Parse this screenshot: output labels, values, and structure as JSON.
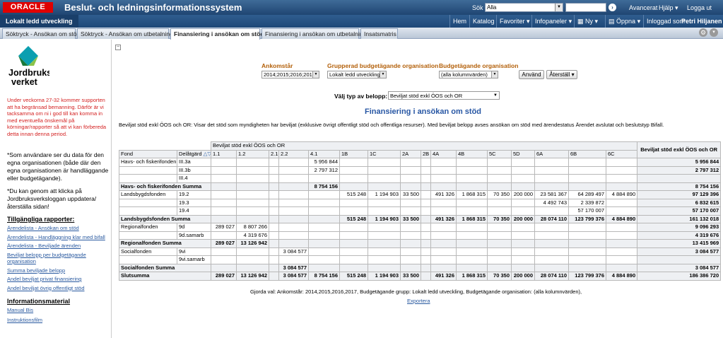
{
  "header": {
    "logo": "ORACLE",
    "app_title": "Beslut- och ledningsinformationssystem",
    "search_label": "Sök",
    "search_scope": "Alla",
    "advanced": "Avancerat",
    "help": "Hjälp",
    "logout": "Logga ut"
  },
  "nav": {
    "context": "Lokalt ledd utveckling",
    "items": [
      "Hem",
      "Katalog",
      "Favoriter",
      "Infopaneler",
      "Ny",
      "Öppna",
      "Inloggad som",
      "Petri Hiljanen"
    ]
  },
  "tabs": [
    "Söktryck - Ansökan om stöd",
    "Söktryck - Ansökan om utbetalning",
    "Finansiering i ansökan om stöd",
    "Finansiering i ansökan om utbetalning",
    "Insatsmatris"
  ],
  "sidebar": {
    "logo_text_1": "Jordbruks",
    "logo_text_2": "verket",
    "notice": "Under veckorna 27-32 kommer supporten att ha begränsad bemanning. Därför är vi tacksamma om ni i god till kan komma in med eventuella önskemål på körningar/rapporter så att vi kan förbereda detta innan denna period.",
    "info1": "*Som användare ser du data för den egna organisationen (både där den egna organisationen är handläggande eller budgetägande).",
    "info2": "*Du kan genom att klicka på Jordbruksverksloggan uppdatera/återställa sidan!",
    "reports_heading": "Tillgängliga rapporter:",
    "reports": [
      "Ärendelista - Ansökan om stöd",
      "Ärendelista - Handläggning klar med bifall",
      "Ärendelista - Beviljade ärenden",
      "Beviljat belopp per budgetägande organisation",
      "Summa beviljade belopp",
      "Andel beviljat privat finansiering",
      "Andel beviljat övrig offentligt stöd"
    ],
    "info_heading": "Informationsmaterial",
    "info_links": [
      "Manual Bis",
      "Instruktionsfilm"
    ]
  },
  "prompts": {
    "ankomstar_label": "Ankomstår",
    "ankomstar_value": "2014;2015;2016;2017",
    "grupp_label": "Grupperad budgetägande organisation",
    "grupp_value": "Lokalt ledd utveckling",
    "budget_label": "Budgetägande organisation",
    "budget_value": "(alla kolumnvärden)",
    "apply": "Använd",
    "reset": "Återställ",
    "type_label": "Välj typ av belopp:",
    "type_value": "Beviljat stöd exkl ÖOS och OR"
  },
  "report": {
    "title": "Finansiering i ansökan om stöd",
    "description": "Beviljat stöd exkl ÖOS och OR: Visar det stöd som myndigheten har beviljat (exklusive övrigt offentligt stöd och offentliga resurser). Med beviljat belopp avses ansökan om stöd med ärendestatus Ärendet avslutat och beslutstyp Bifall.",
    "measure_header": "Beviljat stöd exkl ÖOS och OR",
    "total_header": "Beviljat stöd exkl ÖOS och OR",
    "col_fond": "Fond",
    "col_delatgard": "Delåtgärd",
    "columns": [
      "1.1",
      "1.2",
      "2.1",
      "2.2",
      "4.1",
      "1B",
      "1C",
      "2A",
      "2B",
      "4A",
      "4B",
      "5C",
      "5D",
      "6A",
      "6B",
      "6C"
    ],
    "rows": [
      {
        "fond": "Havs- och fiskerifonden",
        "del": "III.3a",
        "cells": [
          "",
          "",
          "",
          "",
          "5 956 844",
          "",
          "",
          "",
          "",
          "",
          "",
          "",
          "",
          "",
          "",
          ""
        ],
        "total": "5 956 844"
      },
      {
        "fond": "",
        "del": "III.3b",
        "cells": [
          "",
          "",
          "",
          "",
          "2 797 312",
          "",
          "",
          "",
          "",
          "",
          "",
          "",
          "",
          "",
          "",
          ""
        ],
        "total": "2 797 312"
      },
      {
        "fond": "",
        "del": "III.4",
        "cells": [
          "",
          "",
          "",
          "",
          "",
          "",
          "",
          "",
          "",
          "",
          "",
          "",
          "",
          "",
          "",
          ""
        ],
        "total": ""
      },
      {
        "sum": true,
        "fond": "Havs- och fiskerifonden Summa",
        "cells": [
          "",
          "",
          "",
          "",
          "8 754 156",
          "",
          "",
          "",
          "",
          "",
          "",
          "",
          "",
          "",
          "",
          ""
        ],
        "total": "8 754 156"
      },
      {
        "fond": "Landsbygdsfonden",
        "del": "19.2",
        "cells": [
          "",
          "",
          "",
          "",
          "",
          "515 248",
          "1 194 903",
          "33 500",
          "",
          "491 326",
          "1 868 315",
          "70 350",
          "200 000",
          "23 581 367",
          "64 289 497",
          "4 884 890"
        ],
        "total": "97 129 396"
      },
      {
        "fond": "",
        "del": "19.3",
        "cells": [
          "",
          "",
          "",
          "",
          "",
          "",
          "",
          "",
          "",
          "",
          "",
          "",
          "",
          "4 492 743",
          "2 339 872",
          ""
        ],
        "total": "6 832 615"
      },
      {
        "fond": "",
        "del": "19.4",
        "cells": [
          "",
          "",
          "",
          "",
          "",
          "",
          "",
          "",
          "",
          "",
          "",
          "",
          "",
          "",
          "57 170 007",
          ""
        ],
        "total": "57 170 007"
      },
      {
        "sum": true,
        "fond": "Landsbygdsfonden Summa",
        "cells": [
          "",
          "",
          "",
          "",
          "",
          "515 248",
          "1 194 903",
          "33 500",
          "",
          "491 326",
          "1 868 315",
          "70 350",
          "200 000",
          "28 074 110",
          "123 799 376",
          "4 884 890"
        ],
        "total": "161 132 018"
      },
      {
        "fond": "Regionalfonden",
        "del": "9d",
        "cells": [
          "289 027",
          "8 807 266",
          "",
          "",
          "",
          "",
          "",
          "",
          "",
          "",
          "",
          "",
          "",
          "",
          "",
          ""
        ],
        "total": "9 096 293"
      },
      {
        "fond": "",
        "del": "9d.samarb",
        "cells": [
          "",
          "4 319 676",
          "",
          "",
          "",
          "",
          "",
          "",
          "",
          "",
          "",
          "",
          "",
          "",
          "",
          ""
        ],
        "total": "4 319 676"
      },
      {
        "sum": true,
        "fond": "Regionalfonden Summa",
        "cells": [
          "289 027",
          "13 126 942",
          "",
          "",
          "",
          "",
          "",
          "",
          "",
          "",
          "",
          "",
          "",
          "",
          "",
          ""
        ],
        "total": "13 415 969"
      },
      {
        "fond": "Socialfonden",
        "del": "9vi",
        "cells": [
          "",
          "",
          "",
          "3 084 577",
          "",
          "",
          "",
          "",
          "",
          "",
          "",
          "",
          "",
          "",
          "",
          ""
        ],
        "total": "3 084 577"
      },
      {
        "fond": "",
        "del": "9vi.samarb",
        "cells": [
          "",
          "",
          "",
          "",
          "",
          "",
          "",
          "",
          "",
          "",
          "",
          "",
          "",
          "",
          "",
          ""
        ],
        "total": ""
      },
      {
        "sum": true,
        "fond": "Socialfonden Summa",
        "cells": [
          "",
          "",
          "",
          "3 084 577",
          "",
          "",
          "",
          "",
          "",
          "",
          "",
          "",
          "",
          "",
          "",
          ""
        ],
        "total": "3 084 577"
      },
      {
        "sum": true,
        "fond": "Slutsumma",
        "cells": [
          "289 027",
          "13 126 942",
          "",
          "3 084 577",
          "8 754 156",
          "515 248",
          "1 194 903",
          "33 500",
          "",
          "491 326",
          "1 868 315",
          "70 350",
          "200 000",
          "28 074 110",
          "123 799 376",
          "4 884 890"
        ],
        "total": "186 386 720"
      }
    ],
    "selections": "Gjorda val: Ankomstår: 2014,2015,2016,2017, Budgetägande grupp: Lokalt ledd utveckling, Budgetägande organisation: (alla kolumnvärden),",
    "export": "Exportera"
  }
}
